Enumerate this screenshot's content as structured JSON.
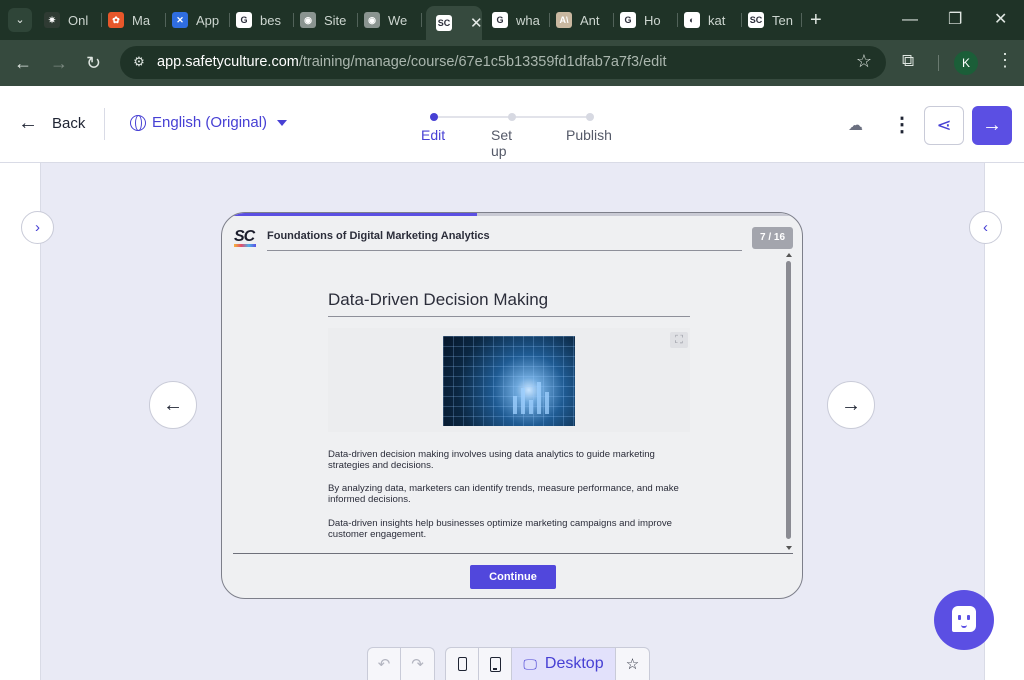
{
  "browser": {
    "tabs": [
      {
        "label": "Onl",
        "fav_color": "#2f3b33",
        "fav_glyph": "✷"
      },
      {
        "label": "Ma",
        "fav_color": "#e8572a",
        "fav_glyph": "✿"
      },
      {
        "label": "App",
        "fav_color": "#2f6de0",
        "fav_glyph": "✕"
      },
      {
        "label": "bes",
        "fav_color": "#ffffff",
        "fav_glyph": "G"
      },
      {
        "label": "Site",
        "fav_color": "#8a9490",
        "fav_glyph": "◉"
      },
      {
        "label": "We",
        "fav_color": "#8a9490",
        "fav_glyph": "◉"
      },
      {
        "label": "",
        "fav_color": "#ffffff",
        "fav_glyph": "SC",
        "active": true
      },
      {
        "label": "wha",
        "fav_color": "#ffffff",
        "fav_glyph": "G"
      },
      {
        "label": "Ant",
        "fav_color": "#c9b8a0",
        "fav_glyph": "A\\"
      },
      {
        "label": "Ho",
        "fav_color": "#ffffff",
        "fav_glyph": "G"
      },
      {
        "label": "kat",
        "fav_color": "#ffffff",
        "fav_glyph": "◐"
      },
      {
        "label": "Ten",
        "fav_color": "#ffffff",
        "fav_glyph": "SC"
      }
    ],
    "url_host": "app.safetyculture.com",
    "url_path": "/training/manage/course/67e1c5b13359fd1dfab7a7f3/edit",
    "profile_initial": "K"
  },
  "header": {
    "back_label": "Back",
    "language": "English (Original)",
    "steps": [
      "Edit",
      "Set up",
      "Publish"
    ],
    "active_step": 0
  },
  "slide": {
    "course_title": "Foundations of Digital Marketing Analytics",
    "page_indicator": "7 / 16",
    "progress": 0.4375,
    "lesson_title": "Data-Driven Decision Making",
    "paragraphs": [
      "Data-driven decision making involves using data analytics to guide marketing strategies and decisions.",
      "By analyzing data, marketers can identify trends, measure performance, and make informed decisions.",
      "Data-driven insights help businesses optimize marketing campaigns and improve customer engagement."
    ],
    "continue_label": "Continue",
    "logo_text": "SC"
  },
  "toolbar": {
    "view_label": "Desktop"
  },
  "colors": {
    "brand": "#5b4fe3",
    "accent_text": "#4740d4"
  }
}
